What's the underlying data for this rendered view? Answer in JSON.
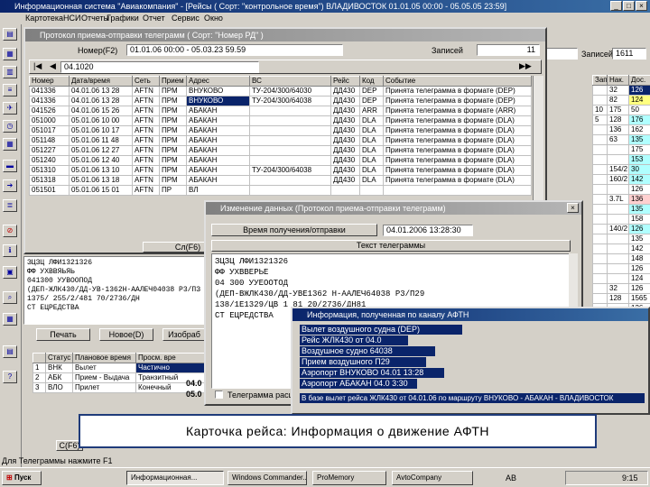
{
  "main_title": "Информационная система \"Авиакомпания\" - [Рейсы ( Сорт: \"контрольное время\") ВЛАДИВОСТОК 01.01.05 00:00 - 05.05.05 23:59]",
  "menu": [
    "Картотека",
    "НСИ",
    "Отчеты",
    "Графики",
    "Отчет",
    "Сервис",
    "Окно"
  ],
  "right_panel": {
    "field1_value": "",
    "field2_label": "Записей",
    "field2_value": "1611",
    "col_headers": [
      "Зап.",
      "Нак.",
      "Дос."
    ],
    "rows": [
      [
        "",
        "32",
        "126"
      ],
      [
        "",
        "82",
        "124"
      ],
      [
        "10",
        "175",
        "50"
      ],
      [
        "5",
        "128",
        "176"
      ],
      [
        "",
        "136",
        "162"
      ],
      [
        "",
        "63",
        "135"
      ],
      [
        "",
        "",
        "175"
      ],
      [
        "",
        "",
        "153"
      ],
      [
        "",
        "154/2",
        "30"
      ],
      [
        "",
        "160/2",
        "142"
      ],
      [
        "",
        "",
        "126"
      ],
      [
        "",
        "3.7L",
        "136"
      ],
      [
        "",
        "",
        "135"
      ],
      [
        "",
        "",
        "158"
      ],
      [
        "",
        "140/2",
        "126"
      ],
      [
        "",
        "",
        "135"
      ],
      [
        "",
        "",
        "142"
      ],
      [
        "",
        "",
        "148"
      ],
      [
        "",
        "",
        "126"
      ],
      [
        "",
        "",
        "124"
      ],
      [
        "",
        "32",
        "126"
      ],
      [
        "",
        "128",
        "1565"
      ],
      [
        "",
        "",
        "136"
      ],
      [
        "",
        "35",
        "150"
      ]
    ]
  },
  "telegram_window": {
    "title": "Протокол приема-отправки телеграмм ( Сорт: \"Номер РД\" )",
    "search_label": "Номер(F2)",
    "search_value": "01.01.06 00:00 - 05.03.23 59.59",
    "count_label": "Записей",
    "count_value": "11",
    "filter_value": "04.1020",
    "headers": [
      "Номер",
      "Дата/время",
      "Сеть",
      "Прием",
      "Адрес",
      "ВС",
      "Рейс",
      "Код",
      "Событие"
    ],
    "rows": [
      [
        "041336",
        "04.01.06 13 28",
        "AFTN",
        "ПРМ",
        "ВНУКОВО",
        "ТУ-204/300/64030",
        "ДД430",
        "DEP",
        "Принята телеграмма в формате (DEP)"
      ],
      [
        "041336",
        "04.01.06 13 28",
        "AFTN",
        "ПРМ",
        "ВНУКОВО",
        "ТУ-204/300/64038",
        "ДД430",
        "DEP",
        "Принята телеграмма в формате (DEP)"
      ],
      [
        "041526",
        "04.01.06 15 26",
        "AFTN",
        "ПРМ",
        "АБАКАН",
        "",
        "ДД430",
        "ARR",
        "Принята телеграмма в формате (ARR)"
      ],
      [
        "051000",
        "05.01.06 10 00",
        "AFTN",
        "ПРМ",
        "АБАКАН",
        "",
        "ДД430",
        "DLA",
        "Принята телеграмма в формате (DLA)"
      ],
      [
        "051017",
        "05.01.06 10 17",
        "AFTN",
        "ПРМ",
        "АБАКАН",
        "",
        "ДД430",
        "DLA",
        "Принята телеграмма в формате (DLA)"
      ],
      [
        "051148",
        "05.01.06 11 48",
        "AFTN",
        "ПРМ",
        "АБАКАН",
        "",
        "ДД430",
        "DLA",
        "Принята телеграмма в формате (DLA)"
      ],
      [
        "051227",
        "05.01.06 12 27",
        "AFTN",
        "ПРМ",
        "АБАКАН",
        "",
        "ДД430",
        "DLA",
        "Принята телеграмма в формате (DLA)"
      ],
      [
        "051240",
        "05.01.06 12 40",
        "AFTN",
        "ПРМ",
        "АБАКАН",
        "",
        "ДД430",
        "DLA",
        "Принята телеграмма в формате (DLA)"
      ],
      [
        "051310",
        "05.01.06 13 10",
        "AFTN",
        "ПРМ",
        "АБАКАН",
        "ТУ-204/300/64038",
        "ДД430",
        "DLA",
        "Принята телеграмма в формате (DLA)"
      ],
      [
        "051318",
        "05.01.06 13 18",
        "AFTN",
        "ПРМ",
        "АБАКАН",
        "",
        "ДД430",
        "DLA",
        "Принята телеграмма в формате (DLA)"
      ],
      [
        "051501",
        "05.01.06 15 01",
        "AFTN",
        "ПР",
        "ВЛ",
        "",
        "",
        "",
        ""
      ]
    ],
    "footer": "Сл(F6)",
    "body_text": "ЗЦЗЦ ЛФИ1321326\nФФ УХВВЯЬЯЬ\n041300 УУВООПОД\n(ДЕП-ЖЛК430/ДД-УВ-1362Н-ААЛЕЧ04038 Р3/ПЗ\n1375/ 255/2/481 70/2736/ДН\nСТ ЕЦРЕДСТВА",
    "buttons": [
      "Печать",
      "Новое(D)",
      "Изобраб"
    ]
  },
  "bottom_table": {
    "headers": [
      "",
      "Статус",
      "Плановое время",
      "Просм. вре"
    ],
    "rows": [
      [
        "1",
        "ВНК",
        "Вылет",
        "Частично"
      ],
      [
        "2",
        "АБК",
        "Прием - Выдача",
        "Транзитный"
      ],
      [
        "3",
        "ВЛО",
        "Прилет",
        "Конечный"
      ]
    ],
    "extra_col": [
      "04.0",
      "05.0"
    ],
    "status_btn": "С(F6)",
    "footer_text": "Для Телеграммы нажмите F1"
  },
  "detail_window": {
    "title": "Изменение данных (Протокол приема-отправки телеграмм)",
    "time_label": "Время получения/отправки",
    "time_value": "04.01.2006 13:28:30",
    "section_label": "Текст телеграммы",
    "text": "ЗЦЗЦ ЛФИ1321326\nФФ УХВВЕРЬЕ\n04 300 УУЕООТОД\n(ДЕП-ВЖЛК430/ДД-УВЕ1362 Н-ААЛЕЧ64038 Р3/П29\n138/1Е1329/ЦВ 1 81 20/2736/ДН81\nСТ ЕЦРЕДСТВА",
    "checkbox_label": "Телеграмма расширенн"
  },
  "info_window": {
    "title": "Информация, полученная по каналу АФТН",
    "lines": [
      "Вылет воздушного судна (DEP)",
      "Рейс ЖЛК430 от 04.0",
      "Воздушное судно 64038",
      "Прием воздушного П29",
      "Аэропорт ВНУКОВО 04.01 13:28",
      "Аэропорт АБАКАН 04.0     3:30"
    ],
    "bottom_text": "В базе вылет рейса ЖЛК430 от 04.01.06 по маршруту ВНУКОВО - АБАКАН - ВЛАДИВОСТОК"
  },
  "caption": "Карточка рейса: Информация о движение АФТН",
  "taskbar": {
    "start": "Пуск",
    "tasks": [
      "Информационная...",
      "Windows Commander...",
      "ProMemory",
      "AvtoCompany"
    ],
    "lang": "AB",
    "clock": "9:15"
  },
  "tool_icons": [
    "file-icon",
    "print-icon",
    "chart-icon",
    "list-icon",
    "plane-icon",
    "clock-icon",
    "table-icon",
    "bus-icon",
    "arrow-icon",
    "close-icon",
    "info-icon",
    "save-icon",
    "search-icon",
    "grid-icon",
    "help-icon"
  ]
}
